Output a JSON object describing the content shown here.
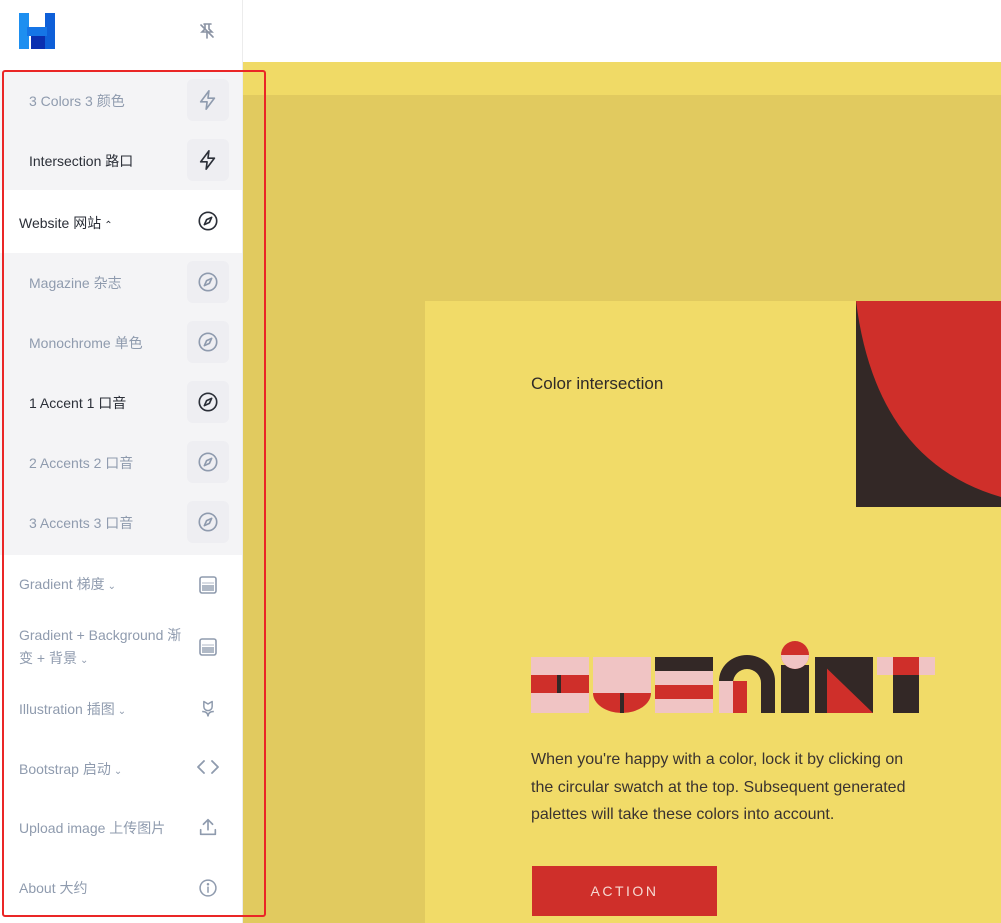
{
  "sidebar": {
    "logo_icon": "h-logo-icon",
    "pin_icon": "pin-off-icon",
    "items": [
      {
        "label": "3 Colors 3 颜色",
        "icon": "bolt-icon"
      },
      {
        "label": "Intersection 路口",
        "icon": "bolt-icon"
      },
      {
        "label": "Website  网站",
        "icon": "compass-icon"
      },
      {
        "label": "Magazine 杂志",
        "icon": "compass-icon"
      },
      {
        "label": "Monochrome 单色",
        "icon": "compass-icon"
      },
      {
        "label": "1 Accent 1 口音",
        "icon": "compass-icon"
      },
      {
        "label": "2 Accents 2 口音",
        "icon": "compass-icon"
      },
      {
        "label": "3 Accents 3 口音",
        "icon": "compass-icon"
      },
      {
        "label": "Gradient  梯度",
        "icon": "gradient-icon"
      },
      {
        "label": "Gradient + Background  渐变 + 背景",
        "icon": "gradient-icon"
      },
      {
        "label": "Illustration  插图",
        "icon": "flower-icon"
      },
      {
        "label": "Bootstrap  启动",
        "icon": "code-icon"
      },
      {
        "label": "Upload image 上传图片",
        "icon": "upload-icon"
      },
      {
        "label": "About 大约",
        "icon": "info-icon"
      }
    ],
    "chevron_up": "⌃",
    "chevron_down": "⌄"
  },
  "main": {
    "card_title": "Color intersection",
    "logo_art_label": "HUEMINT",
    "description": "When you're happy with a color, lock it by clicking on the circular swatch at the top. Subsequent generated palettes will take these colors into account.",
    "action_label": "ACTION"
  },
  "colors": {
    "yellow": "#f1db68",
    "dark_yellow": "#e1ca5f",
    "red": "#cf2f2a",
    "pink": "#f0c4c4",
    "dark": "#332826",
    "highlight": "#ea2626"
  }
}
